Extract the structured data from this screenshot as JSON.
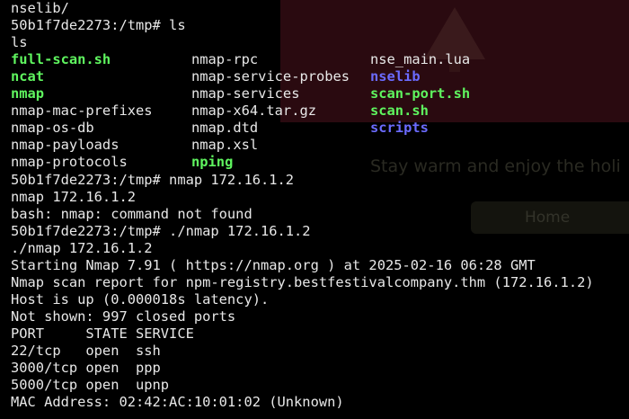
{
  "background_page": {
    "greeting": "Stay warm and enjoy the holi",
    "home_button": "Home"
  },
  "colors": {
    "terminal_background": "#000000",
    "text": "#e8e8e8",
    "executable": "#5ff55f",
    "directory": "#6b6bff"
  },
  "terminal": {
    "pre_lines": [
      "nselib/",
      "50b1f7de2273:/tmp# ls",
      "ls"
    ],
    "listing": [
      [
        {
          "name": "full-scan.sh",
          "kind": "executable"
        },
        {
          "name": "nmap-rpc",
          "kind": "file"
        },
        {
          "name": "nse_main.lua",
          "kind": "file"
        }
      ],
      [
        {
          "name": "ncat",
          "kind": "executable"
        },
        {
          "name": "nmap-service-probes",
          "kind": "file"
        },
        {
          "name": "nselib",
          "kind": "directory"
        }
      ],
      [
        {
          "name": "nmap",
          "kind": "executable"
        },
        {
          "name": "nmap-services",
          "kind": "file"
        },
        {
          "name": "scan-port.sh",
          "kind": "executable"
        }
      ],
      [
        {
          "name": "nmap-mac-prefixes",
          "kind": "file"
        },
        {
          "name": "nmap-x64.tar.gz",
          "kind": "file"
        },
        {
          "name": "scan.sh",
          "kind": "executable"
        }
      ],
      [
        {
          "name": "nmap-os-db",
          "kind": "file"
        },
        {
          "name": "nmap.dtd",
          "kind": "file"
        },
        {
          "name": "scripts",
          "kind": "directory"
        }
      ],
      [
        {
          "name": "nmap-payloads",
          "kind": "file"
        },
        {
          "name": "nmap.xsl",
          "kind": "file"
        },
        {
          "name": "",
          "kind": "file"
        }
      ],
      [
        {
          "name": "nmap-protocols",
          "kind": "file"
        },
        {
          "name": "nping",
          "kind": "executable"
        },
        {
          "name": "",
          "kind": "file"
        }
      ]
    ],
    "post_lines": [
      "50b1f7de2273:/tmp# nmap 172.16.1.2",
      "nmap 172.16.1.2",
      "bash: nmap: command not found",
      "50b1f7de2273:/tmp# ./nmap 172.16.1.2",
      "./nmap 172.16.1.2",
      "Starting Nmap 7.91 ( https://nmap.org ) at 2025-02-16 06:28 GMT",
      "Nmap scan report for npm-registry.bestfestivalcompany.thm (172.16.1.2)",
      "Host is up (0.000018s latency).",
      "Not shown: 997 closed ports",
      "PORT     STATE SERVICE",
      "22/tcp   open  ssh",
      "3000/tcp open  ppp",
      "5000/tcp open  upnp",
      "MAC Address: 02:42:AC:10:01:02 (Unknown)"
    ]
  }
}
